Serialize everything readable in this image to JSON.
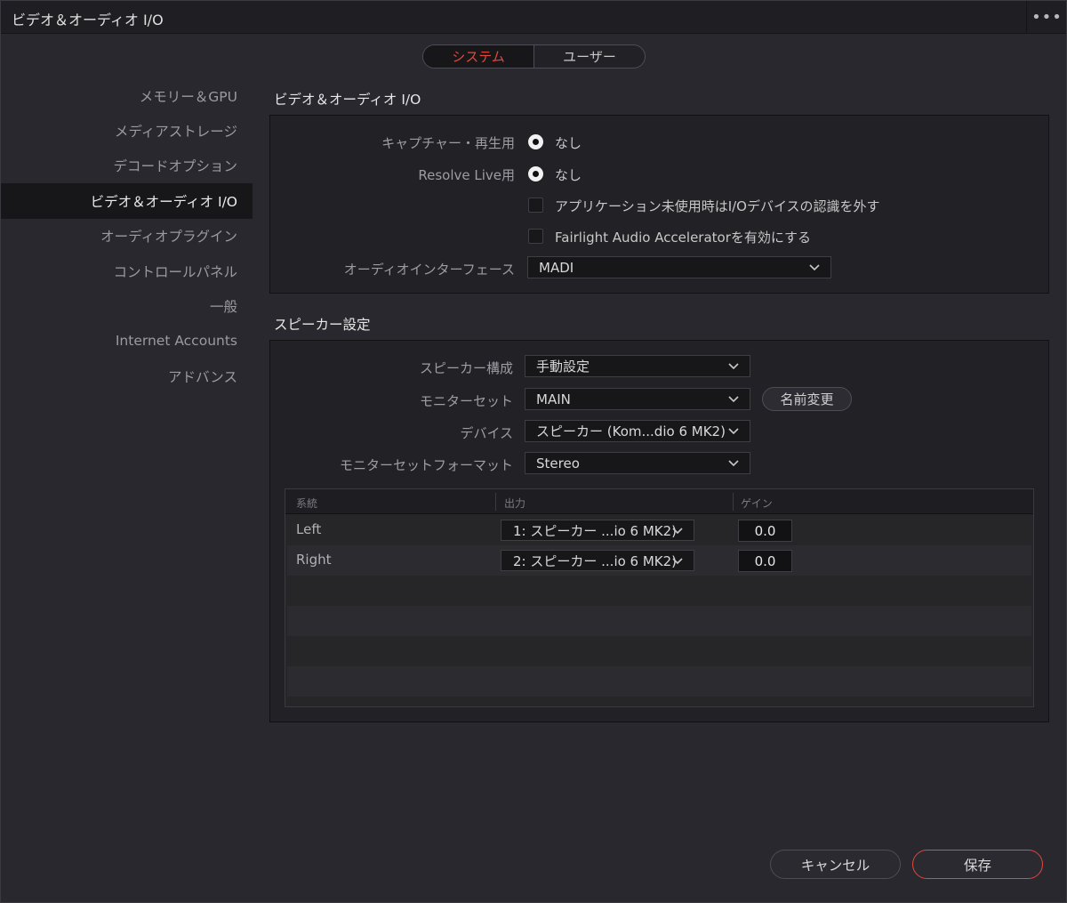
{
  "window": {
    "title": "ビデオ＆オーディオ I/O",
    "menu_glyph": "•••"
  },
  "tabs": [
    {
      "label": "システム",
      "active": true
    },
    {
      "label": "ユーザー",
      "active": false
    }
  ],
  "sidebar": {
    "items": [
      {
        "label": "メモリー＆GPU"
      },
      {
        "label": "メディアストレージ"
      },
      {
        "label": "デコードオプション"
      },
      {
        "label": "ビデオ＆オーディオ I/O",
        "active": true
      },
      {
        "label": "オーディオプラグイン"
      },
      {
        "label": "コントロールパネル"
      },
      {
        "label": "一般"
      },
      {
        "label": "Internet Accounts"
      },
      {
        "label": "アドバンス"
      }
    ]
  },
  "video_audio": {
    "title": "ビデオ＆オーディオ I/O",
    "capture_label": "キャプチャー・再生用",
    "capture_value": "なし",
    "resolve_live_label": "Resolve Live用",
    "resolve_live_value": "なし",
    "release_io_label": "アプリケーション未使用時はI/Oデバイスの認識を外す",
    "release_io_checked": false,
    "fairlight_label": "Fairlight Audio Acceleratorを有効にする",
    "fairlight_checked": false,
    "audio_interface_label": "オーディオインターフェース",
    "audio_interface_value": "MADI"
  },
  "speaker": {
    "title": "スピーカー設定",
    "config_label": "スピーカー構成",
    "config_value": "手動設定",
    "monitor_set_label": "モニターセット",
    "monitor_set_value": "MAIN",
    "rename_label": "名前変更",
    "device_label": "デバイス",
    "device_value": "スピーカー (Kom...dio 6 MK2)",
    "format_label": "モニターセットフォーマット",
    "format_value": "Stereo",
    "table": {
      "headers": [
        "系統",
        "出力",
        "ゲイン"
      ],
      "rows": [
        {
          "channel": "Left",
          "output": "1: スピーカー ...io 6 MK2)",
          "gain": "0.0"
        },
        {
          "channel": "Right",
          "output": "2: スピーカー ...io 6 MK2)",
          "gain": "0.0"
        }
      ]
    }
  },
  "footer": {
    "cancel_label": "キャンセル",
    "save_label": "保存"
  },
  "colors": {
    "accent": "#e6463c",
    "background": "#28282e",
    "panel": "#222226"
  }
}
